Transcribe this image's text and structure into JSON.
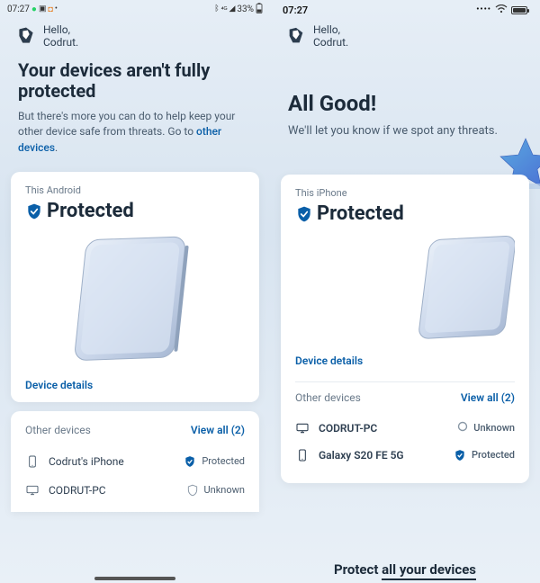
{
  "android": {
    "status": {
      "time": "07:27",
      "battery": "33%"
    },
    "greeting": {
      "hello": "Hello,",
      "name": "Codrut."
    },
    "headline": "Your devices aren't fully protected",
    "sub1": "But there's more you can do to help keep your other device safe from threats. Go to ",
    "sub_link": "other devices",
    "card_label": "This Android",
    "protected": "Protected",
    "device_details": "Device details",
    "other_label": "Other devices",
    "view_all": "View all (2)",
    "dev1_name": "Codrut's iPhone",
    "dev1_status": "Protected",
    "dev2_name": "CODRUT-PC",
    "dev2_status": "Unknown"
  },
  "ios": {
    "status": {
      "time": "07:27"
    },
    "greeting": {
      "hello": "Hello,",
      "name": "Codrut."
    },
    "headline": "All Good!",
    "sub": "We'll let you know if we spot any threats.",
    "card_label": "This iPhone",
    "protected": "Protected",
    "device_details": "Device details",
    "other_label": "Other devices",
    "view_all": "View all (2)",
    "dev1_name": "CODRUT-PC",
    "dev1_status": "Unknown",
    "dev2_name": "Galaxy S20 FE 5G",
    "dev2_status": "Protected",
    "banner_a": "Protect ",
    "banner_b": "all your devices"
  }
}
